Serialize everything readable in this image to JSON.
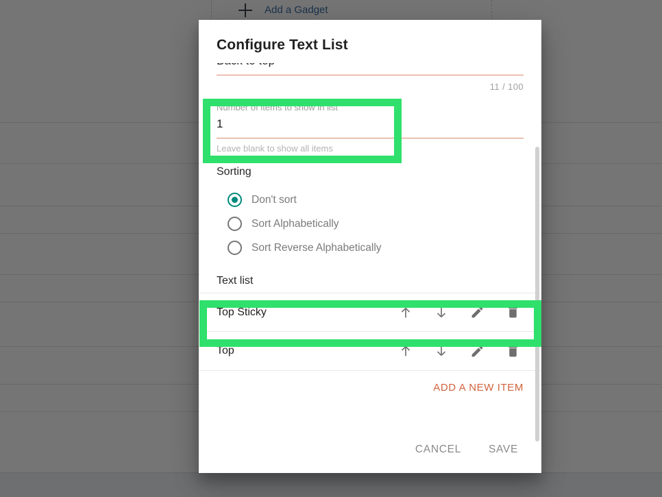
{
  "background": {
    "add_gadget_label": "Add a Gadget",
    "plus_icon": "plus-icon",
    "row_offsets": [
      178,
      238,
      300,
      340,
      400,
      440,
      505,
      560,
      600
    ],
    "overlay_color": "#00000089"
  },
  "dialog": {
    "title": "Configure Text List",
    "text_field": {
      "value": "Back to top",
      "counter": "11 / 100",
      "underline_color": "#d98a6b"
    },
    "number_field": {
      "label": "Number of items to show in list",
      "value": "1",
      "hint": "Leave blank to show all items",
      "underline_color": "#d98a6b"
    },
    "sorting": {
      "heading": "Sorting",
      "selected_index": 0,
      "accent_color": "#00897b",
      "options": [
        {
          "label": "Don't sort",
          "selected": true
        },
        {
          "label": "Sort Alphabetically",
          "selected": false
        },
        {
          "label": "Sort Reverse Alphabetically",
          "selected": false
        }
      ]
    },
    "text_list": {
      "heading": "Text list",
      "items": [
        {
          "label": "Top Sticky"
        },
        {
          "label": "Top"
        }
      ],
      "row_actions": [
        {
          "name": "move-up-icon",
          "title": "Move up"
        },
        {
          "name": "move-down-icon",
          "title": "Move down"
        },
        {
          "name": "edit-pencil-icon",
          "title": "Edit"
        },
        {
          "name": "delete-trash-icon",
          "title": "Delete"
        }
      ],
      "add_item_label": "ADD A NEW ITEM",
      "add_item_color": "#d2623c"
    },
    "actions": {
      "cancel_label": "CANCEL",
      "save_label": "SAVE"
    },
    "scrollbar": {
      "visible": true
    }
  },
  "annotations": {
    "color": "#2fe06c",
    "boxes": [
      {
        "name": "highlight-number-field"
      },
      {
        "name": "highlight-top-sticky-row"
      }
    ]
  }
}
